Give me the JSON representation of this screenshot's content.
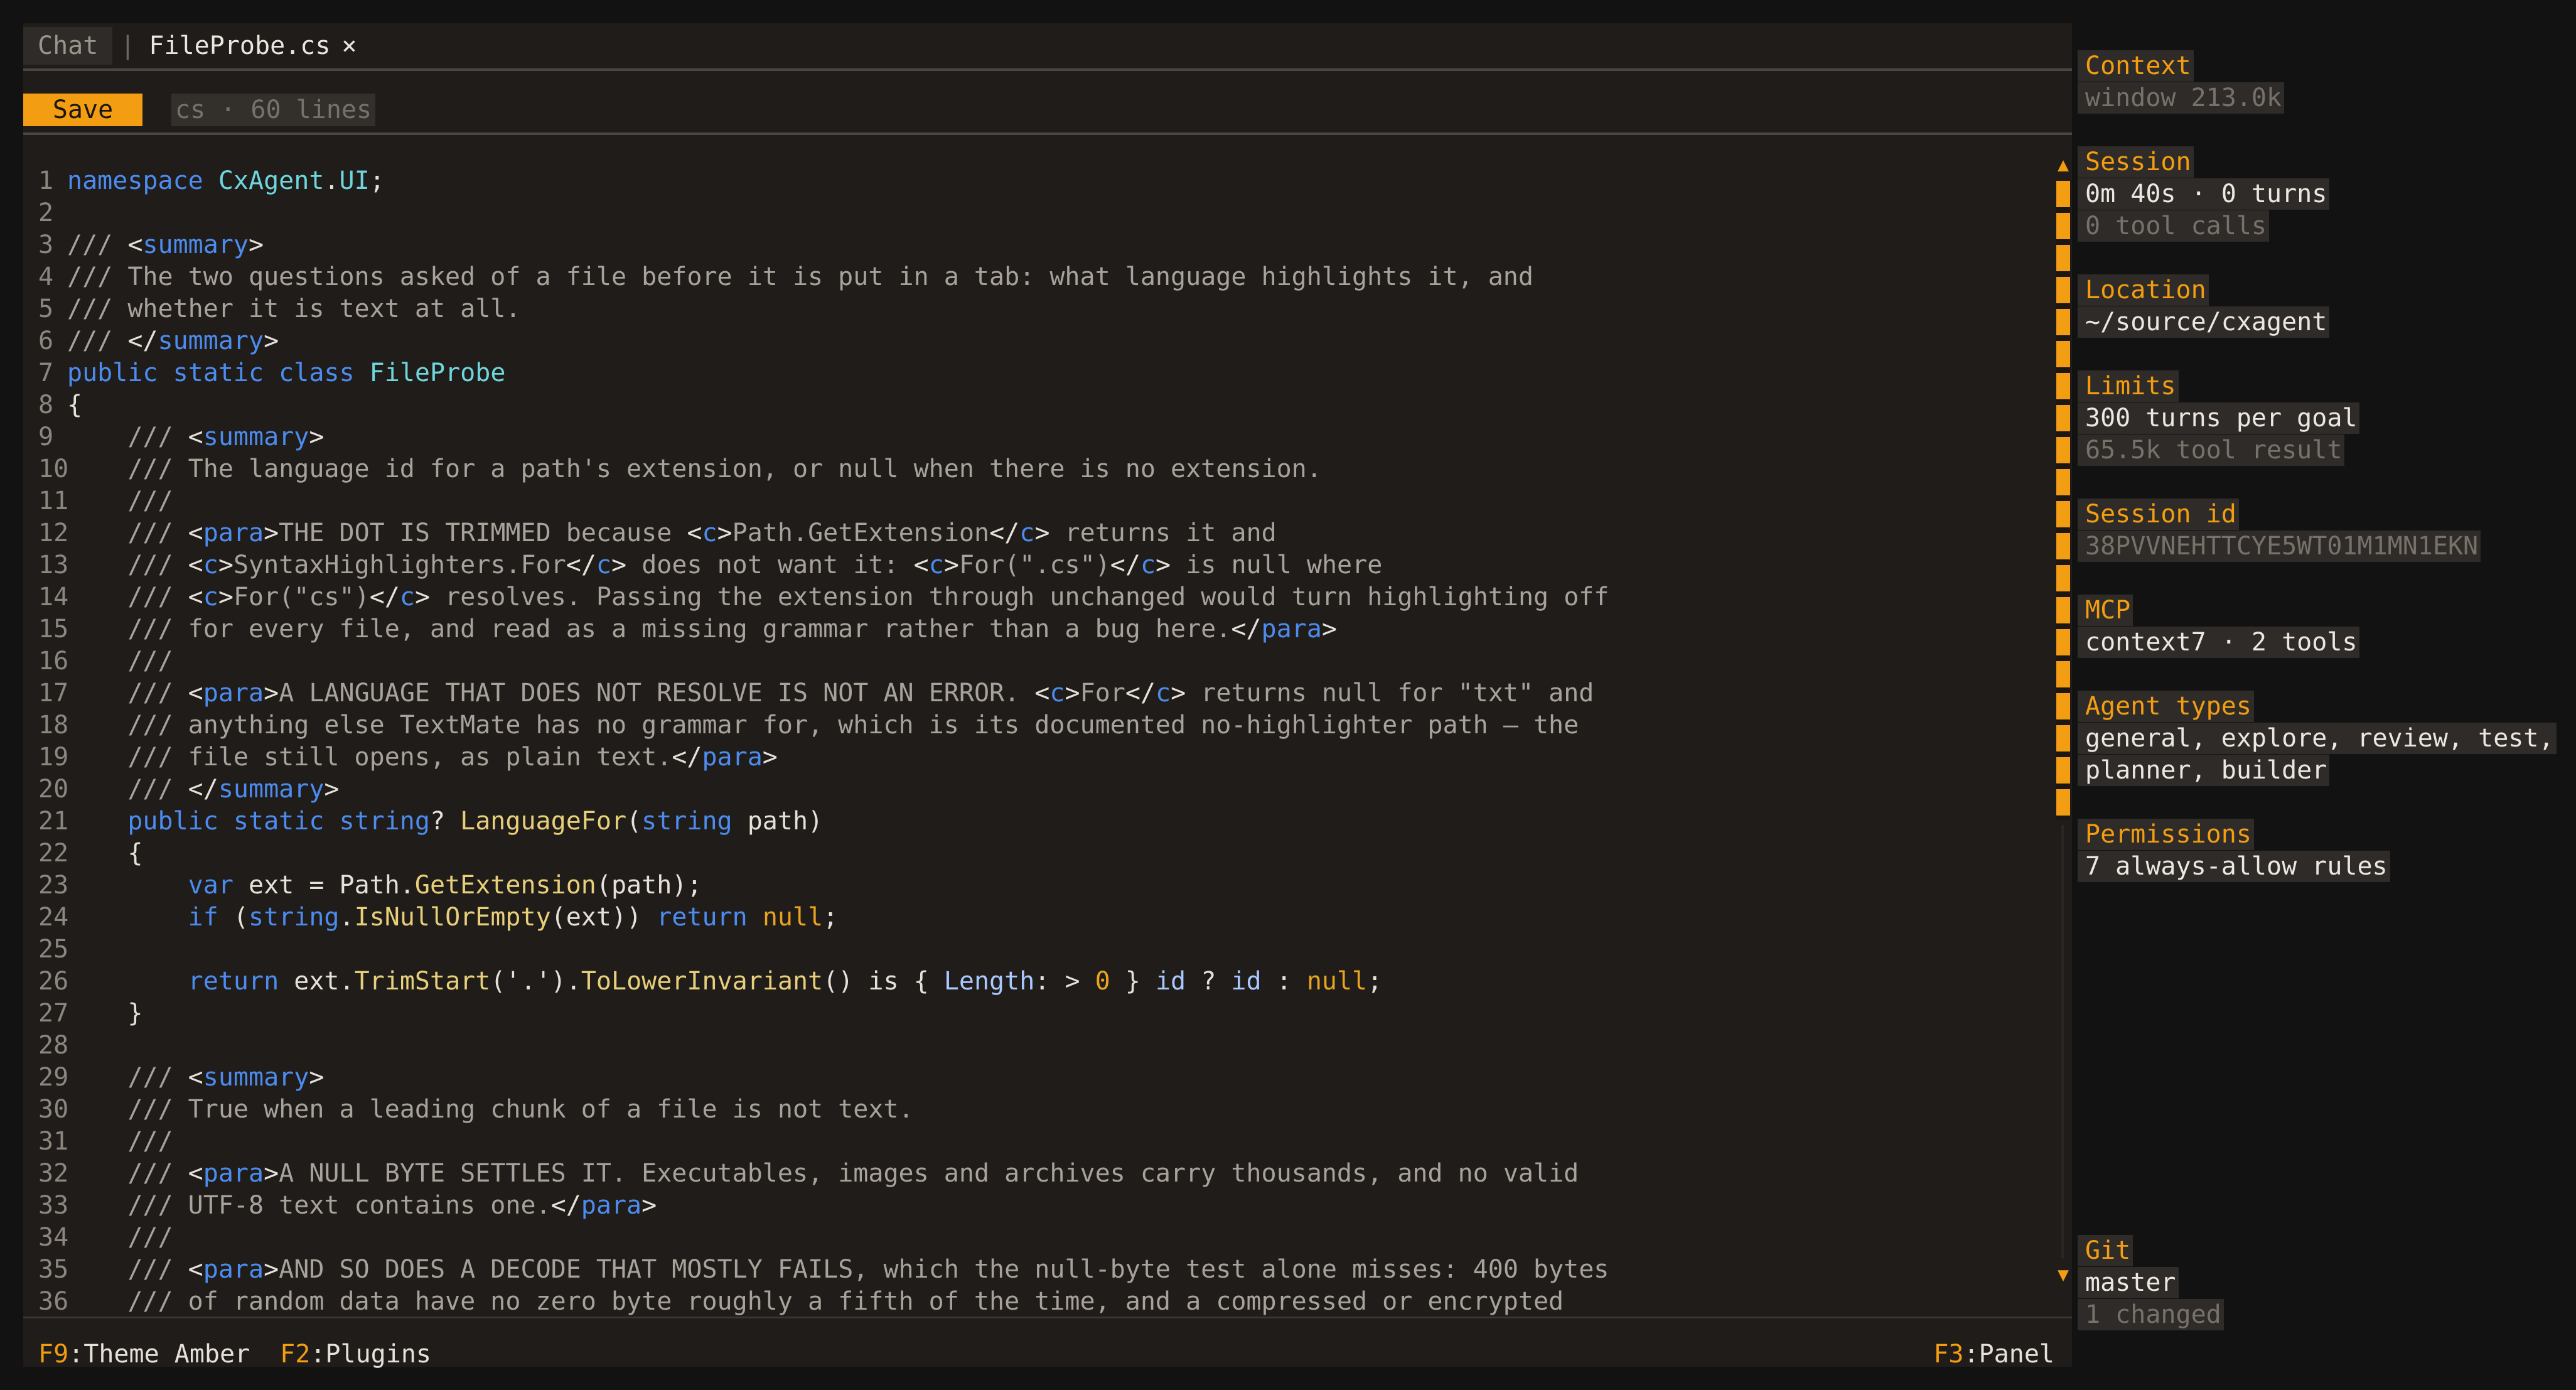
{
  "tabs": {
    "chat_label": "Chat",
    "separator": "|",
    "active_label": "FileProbe.cs",
    "close_glyph": "×"
  },
  "toolbar": {
    "save_label": "Save",
    "file_meta": "cs · 60 lines"
  },
  "editor": {
    "lines": [
      {
        "n": "1",
        "html": "<span class=\"k\">namespace</span> <span class=\"t\">CxAgent</span>.<span class=\"t\">UI</span>;"
      },
      {
        "n": "2",
        "html": ""
      },
      {
        "n": "3",
        "html": "<span class=\"c\">/// </span>&lt;<span class=\"k\">summary</span>&gt;"
      },
      {
        "n": "4",
        "html": "<span class=\"c\">/// The two questions asked of a file before it is put in a tab: what language highlights it, and</span>"
      },
      {
        "n": "5",
        "html": "<span class=\"c\">/// whether it is text at all.</span>"
      },
      {
        "n": "6",
        "html": "<span class=\"c\">/// </span>&lt;/<span class=\"k\">summary</span>&gt;"
      },
      {
        "n": "7",
        "html": "<span class=\"k\">public static class</span> <span class=\"t\">FileProbe</span>"
      },
      {
        "n": "8",
        "html": "{"
      },
      {
        "n": "9",
        "html": "    <span class=\"c\">/// </span>&lt;<span class=\"k\">summary</span>&gt;"
      },
      {
        "n": "10",
        "html": "    <span class=\"c\">/// The language id for a path's extension, or null when there is no extension.</span>"
      },
      {
        "n": "11",
        "html": "    <span class=\"c\">///</span>"
      },
      {
        "n": "12",
        "html": "    <span class=\"c\">/// </span>&lt;<span class=\"k\">para</span>&gt;<span class=\"c\">THE DOT IS TRIMMED because </span>&lt;<span class=\"k\">c</span>&gt;<span class=\"c\">Path.GetExtension</span>&lt;/<span class=\"k\">c</span>&gt;<span class=\"c\"> returns it and</span>"
      },
      {
        "n": "13",
        "html": "    <span class=\"c\">/// </span>&lt;<span class=\"k\">c</span>&gt;<span class=\"c\">SyntaxHighlighters.For</span>&lt;/<span class=\"k\">c</span>&gt;<span class=\"c\"> does not want it: </span>&lt;<span class=\"k\">c</span>&gt;<span class=\"c\">For(\".cs\")</span>&lt;/<span class=\"k\">c</span>&gt;<span class=\"c\"> is null where</span>"
      },
      {
        "n": "14",
        "html": "    <span class=\"c\">/// </span>&lt;<span class=\"k\">c</span>&gt;<span class=\"c\">For(\"cs\")</span>&lt;/<span class=\"k\">c</span>&gt;<span class=\"c\"> resolves. Passing the extension through unchanged would turn highlighting off</span>"
      },
      {
        "n": "15",
        "html": "    <span class=\"c\">/// for every file, and read as a missing grammar rather than a bug here.</span>&lt;/<span class=\"k\">para</span>&gt;"
      },
      {
        "n": "16",
        "html": "    <span class=\"c\">///</span>"
      },
      {
        "n": "17",
        "html": "    <span class=\"c\">/// </span>&lt;<span class=\"k\">para</span>&gt;<span class=\"c\">A LANGUAGE THAT DOES NOT RESOLVE IS NOT AN ERROR. </span>&lt;<span class=\"k\">c</span>&gt;<span class=\"c\">For</span>&lt;/<span class=\"k\">c</span>&gt;<span class=\"c\"> returns null for \"txt\" and</span>"
      },
      {
        "n": "18",
        "html": "    <span class=\"c\">/// anything else TextMate has no grammar for, which is its documented no-highlighter path — the</span>"
      },
      {
        "n": "19",
        "html": "    <span class=\"c\">/// file still opens, as plain text.</span>&lt;/<span class=\"k\">para</span>&gt;"
      },
      {
        "n": "20",
        "html": "    <span class=\"c\">/// </span>&lt;/<span class=\"k\">summary</span>&gt;"
      },
      {
        "n": "21",
        "html": "    <span class=\"k\">public static string</span>? <span class=\"f\">LanguageFor</span>(<span class=\"k\">string</span> path)"
      },
      {
        "n": "22",
        "html": "    {"
      },
      {
        "n": "23",
        "html": "        <span class=\"k\">var</span> ext = Path.<span class=\"f\">GetExtension</span>(path);"
      },
      {
        "n": "24",
        "html": "        <span class=\"k\">if</span> (<span class=\"k\">string</span>.<span class=\"f\">IsNullOrEmpty</span>(ext)) <span class=\"k\">return</span> <span class=\"n\">null</span>;"
      },
      {
        "n": "25",
        "html": ""
      },
      {
        "n": "26",
        "html": "        <span class=\"k\">return</span> ext.<span class=\"f\">TrimStart</span>('.').<span class=\"f\">ToLowerInvariant</span>() is { <span class=\"p\">Length</span>: &gt; <span class=\"n\">0</span> } <span class=\"p\">id</span> ? <span class=\"p\">id</span> : <span class=\"n\">null</span>;"
      },
      {
        "n": "27",
        "html": "    }"
      },
      {
        "n": "28",
        "html": ""
      },
      {
        "n": "29",
        "html": "    <span class=\"c\">/// </span>&lt;<span class=\"k\">summary</span>&gt;"
      },
      {
        "n": "30",
        "html": "    <span class=\"c\">/// True when a leading chunk of a file is not text.</span>"
      },
      {
        "n": "31",
        "html": "    <span class=\"c\">///</span>"
      },
      {
        "n": "32",
        "html": "    <span class=\"c\">/// </span>&lt;<span class=\"k\">para</span>&gt;<span class=\"c\">A NULL BYTE SETTLES IT. Executables, images and archives carry thousands, and no valid</span>"
      },
      {
        "n": "33",
        "html": "    <span class=\"c\">/// UTF-8 text contains one.</span>&lt;/<span class=\"k\">para</span>&gt;"
      },
      {
        "n": "34",
        "html": "    <span class=\"c\">///</span>"
      },
      {
        "n": "35",
        "html": "    <span class=\"c\">/// </span>&lt;<span class=\"k\">para</span>&gt;<span class=\"c\">AND SO DOES A DECODE THAT MOSTLY FAILS, which the null-byte test alone misses: 400 bytes</span>"
      },
      {
        "n": "36",
        "html": "    <span class=\"c\">/// of random data have no zero byte roughly a fifth of the time, and a compressed or encrypted</span>"
      }
    ]
  },
  "statusbar": {
    "f9_key": "F9",
    "f9_label": ":Theme Amber",
    "f2_key": "F2",
    "f2_label": ":Plugins",
    "f3_key": "F3",
    "f3_label": ":Panel"
  },
  "scrollbar": {
    "up_glyph": "▲",
    "down_glyph": "▼"
  },
  "side": {
    "context": {
      "title": "Context",
      "lines": [
        "window 213.0k"
      ]
    },
    "session": {
      "title": "Session",
      "line1": "0m 40s · 0 turns",
      "line2": "0 tool calls"
    },
    "location": {
      "title": "Location",
      "line1": "~/source/cxagent"
    },
    "limits": {
      "title": "Limits",
      "line1": "300 turns per goal",
      "line2": "65.5k tool result"
    },
    "session_id": {
      "title": "Session id",
      "line1": "38PVVNEHTTCYE5WT01M1MN1EKN"
    },
    "mcp": {
      "title": "MCP",
      "line1": "context7 · 2 tools"
    },
    "agent_types": {
      "title": "Agent types",
      "line1": "general, explore, review, test,",
      "line2": "planner, builder"
    },
    "permissions": {
      "title": "Permissions",
      "line1": "7 always-allow rules"
    },
    "git": {
      "title": "Git",
      "line1": "master",
      "line2": "1 changed"
    }
  },
  "colors": {
    "accent": "#f29d12",
    "background": "#121212",
    "panel": "#1f1c19",
    "keyword": "#4c8cf0",
    "type": "#6fd6de",
    "function": "#e8cf7a",
    "comment": "#a8a29b"
  }
}
